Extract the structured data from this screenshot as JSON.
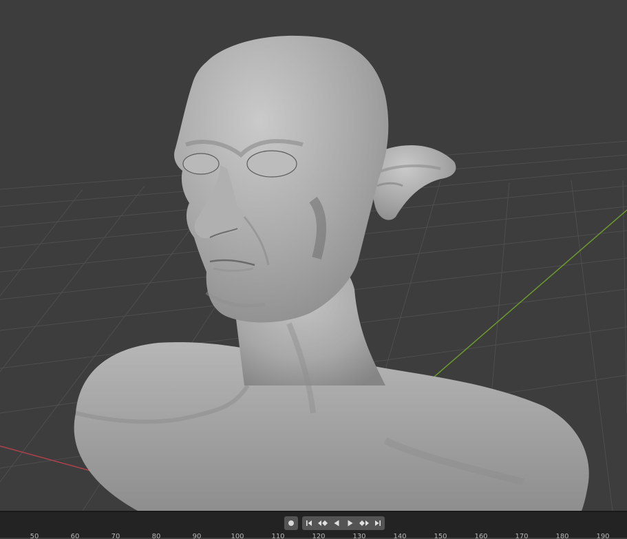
{
  "app": "Blender",
  "viewport": {
    "background": "#3d3d3d",
    "grid_color": "#505050",
    "x_axis_color": "#c0404c",
    "y_axis_color": "#6c9a2c",
    "model": "sculpted-bust",
    "model_color": "#9e9e9e"
  },
  "timeline": {
    "controls": [
      {
        "name": "record-button",
        "icon": "record-icon"
      },
      {
        "name": "jump-to-start-button",
        "icon": "jump-start-icon"
      },
      {
        "name": "previous-keyframe-button",
        "icon": "prev-keyframe-icon"
      },
      {
        "name": "play-reverse-button",
        "icon": "play-reverse-icon"
      },
      {
        "name": "play-button",
        "icon": "play-icon"
      },
      {
        "name": "next-keyframe-button",
        "icon": "next-keyframe-icon"
      },
      {
        "name": "jump-to-end-button",
        "icon": "jump-end-icon"
      }
    ],
    "frame_ticks": [
      "50",
      "60",
      "70",
      "80",
      "90",
      "100",
      "110",
      "120",
      "130",
      "140",
      "150",
      "160",
      "170",
      "180",
      "190"
    ]
  }
}
